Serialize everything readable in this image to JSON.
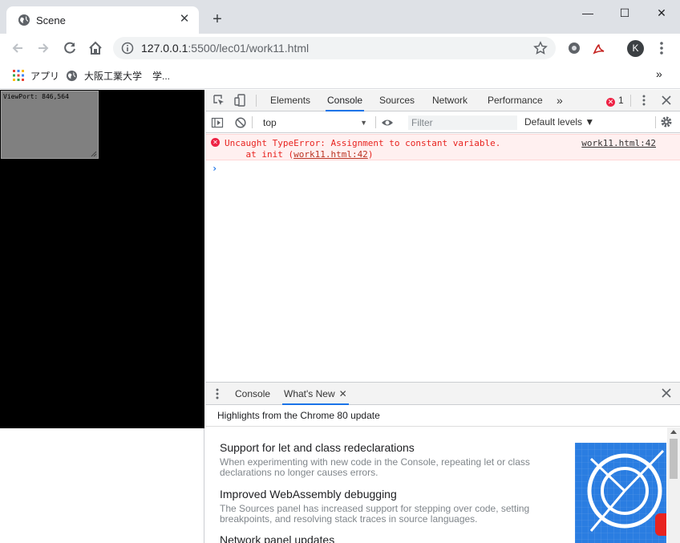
{
  "browser": {
    "tab": {
      "title": "Scene",
      "close": "✕"
    },
    "new_tab": "+",
    "window": {
      "minimize": "—",
      "maximize": "☐",
      "close": "✕"
    },
    "toolbar": {
      "url_host": "127.0.0.1",
      "url_rest": ":5500/lec01/work11.html",
      "avatar_letter": "K"
    },
    "bookmarks": [
      {
        "label": "アプリ",
        "icon": "apps-grid-icon"
      },
      {
        "label": "大阪工業大学",
        "icon": "globe-icon"
      },
      {
        "label": "学...",
        "icon": ""
      }
    ],
    "bookmarks_overflow": "»"
  },
  "page": {
    "viewport_label": "ViewPort: 846,564",
    "colors": {
      "scene_bg": "#000000",
      "viewport_box": "#808080"
    }
  },
  "devtools": {
    "tabs": [
      "Elements",
      "Console",
      "Sources",
      "Network",
      "Performance"
    ],
    "active_tab": "Console",
    "more_tabs": "»",
    "error_count": "1",
    "context": "top",
    "filter_placeholder": "Filter",
    "levels": "Default levels ▼",
    "console": {
      "error_line1": "Uncaught TypeError: Assignment to constant variable.",
      "error_line2_prefix": "    at init (",
      "error_line2_link": "work11.html:42",
      "error_line2_suffix": ")",
      "error_source": "work11.html:42",
      "prompt": "›"
    },
    "drawer": {
      "tabs": [
        "Console",
        "What's New"
      ],
      "active_tab": "What's New",
      "highlights": "Highlights from the Chrome 80 update",
      "items": [
        {
          "title": "Support for let and class redeclarations",
          "desc": "When experimenting with new code in the Console, repeating let or class declarations no longer causes errors."
        },
        {
          "title": "Improved WebAssembly debugging",
          "desc": "The Sources panel has increased support for stepping over code, setting breakpoints, and resolving stack traces in source languages."
        },
        {
          "title": "Network panel updates",
          "desc": ""
        }
      ]
    },
    "colors": {
      "error_text": "#e8231f",
      "error_bg": "#fff0f0",
      "accent": "#1a73e8"
    }
  }
}
